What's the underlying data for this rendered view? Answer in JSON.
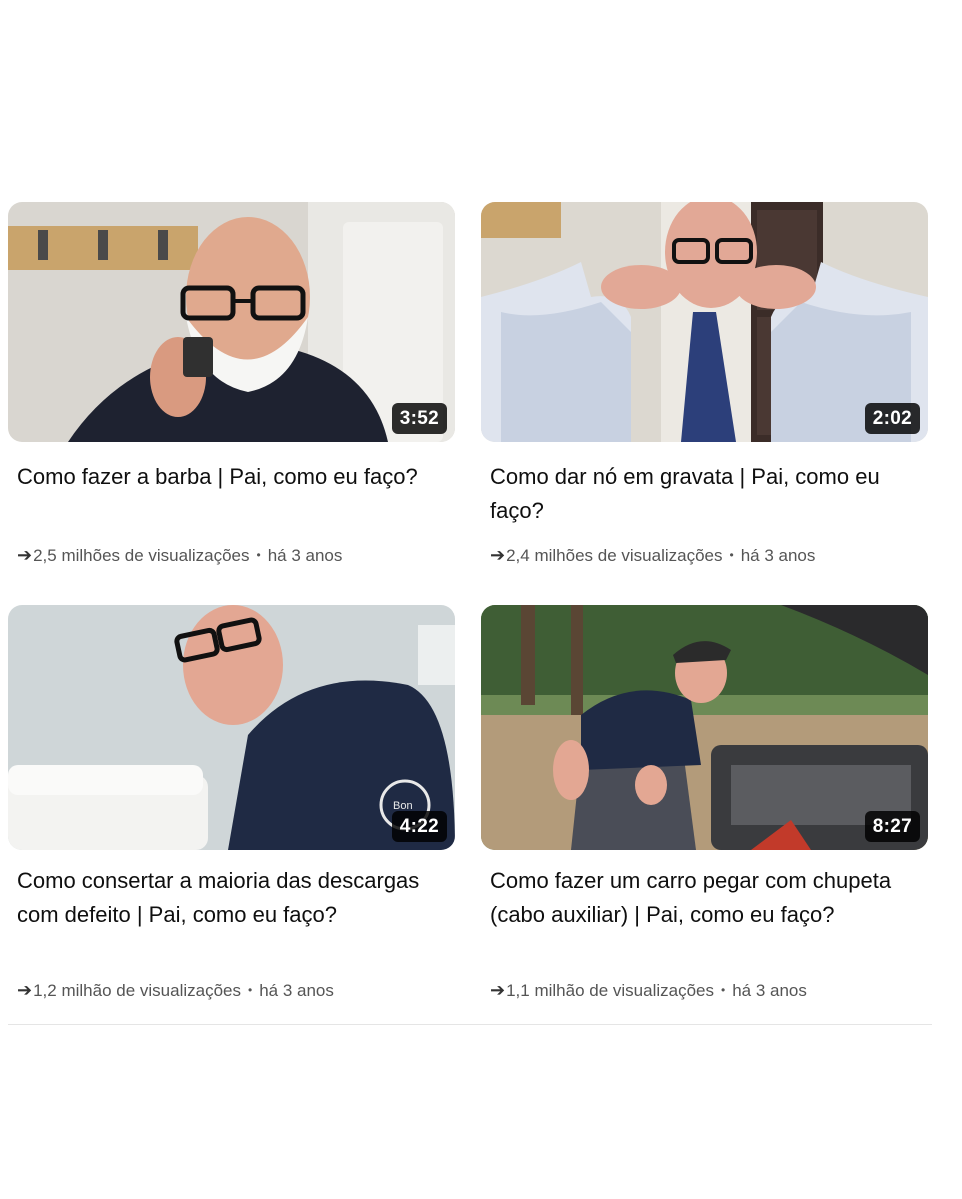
{
  "videos": [
    {
      "title": "Como fazer a barba | Pai, como eu faço?",
      "duration": "3:52",
      "views": "2,5 milhões de visualizações",
      "age": "há 3 anos"
    },
    {
      "title": "Como dar nó em gravata | Pai, como eu faço?",
      "duration": "2:02",
      "views": "2,4 milhões de visualizações",
      "age": "há 3 anos"
    },
    {
      "title": "Como consertar a maioria das descargas com defeito | Pai, como eu faço?",
      "duration": "4:22",
      "views": "1,2 milhão de visualizações",
      "age": "há 3 anos"
    },
    {
      "title": "Como fazer um carro pegar com chupeta (cabo auxiliar) | Pai, como eu faço?",
      "duration": "8:27",
      "views": "1,1 milhão de visualizações",
      "age": "há 3 anos"
    }
  ],
  "icons": {
    "view_arrow": "arrow-right-icon",
    "separator": "•"
  },
  "colors": {
    "title": "#0f0f0f",
    "meta": "#555555",
    "duration_bg": "#000000"
  }
}
